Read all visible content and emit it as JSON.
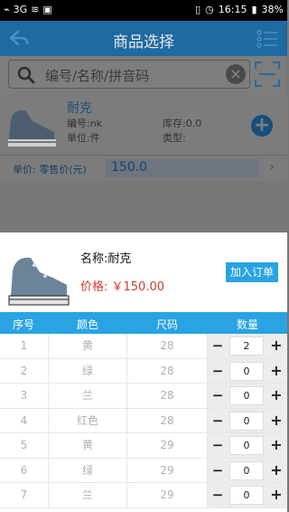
{
  "status_bar": {
    "carrier": "3G",
    "time": "16:15",
    "battery": "38%"
  },
  "header": {
    "title": "商品选择"
  },
  "search": {
    "placeholder": "编号/名称/拼音码"
  },
  "product": {
    "name": "耐克",
    "code": "编号:nk",
    "unit": "单位:件",
    "stock": "库存:0.0",
    "category": "类型:",
    "price_label": "单价:  零售价(元)",
    "price_value": "150.0"
  },
  "sheet": {
    "name_line": "名称:耐克",
    "price_line": "价格: ￥150.00",
    "add_order": "加入订单",
    "columns": [
      "序号",
      "颜色",
      "尺码",
      "数量"
    ],
    "rows": [
      {
        "index": "1",
        "color": "黄",
        "size": "28",
        "qty": "2"
      },
      {
        "index": "2",
        "color": "绿",
        "size": "28",
        "qty": "0"
      },
      {
        "index": "3",
        "color": "兰",
        "size": "28",
        "qty": "0"
      },
      {
        "index": "4",
        "color": "红色",
        "size": "28",
        "qty": "0"
      },
      {
        "index": "5",
        "color": "黄",
        "size": "29",
        "qty": "0"
      },
      {
        "index": "6",
        "color": "绿",
        "size": "29",
        "qty": "0"
      },
      {
        "index": "7",
        "color": "兰",
        "size": "29",
        "qty": "0"
      }
    ],
    "minus_label": "−",
    "plus_label": "+"
  },
  "colors": {
    "header": "#1e6aa2",
    "accent": "#29a3e3",
    "price": "#d13a2f"
  }
}
